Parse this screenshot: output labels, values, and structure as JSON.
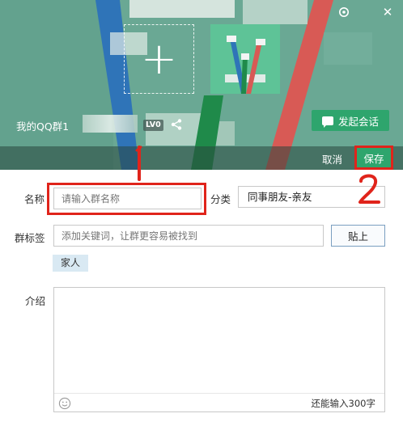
{
  "header": {
    "group_name": "我的QQ群1",
    "level_badge": "LV0",
    "start_chat_label": "发起会话",
    "add_avatar_symbol": "+",
    "close_symbol": "✕",
    "icons": [
      "settings-icon",
      "close-icon",
      "plus-icon",
      "share-icon",
      "chat-bubble-icon"
    ]
  },
  "actions": {
    "cancel_label": "取消",
    "save_label": "保存"
  },
  "form": {
    "name_label": "名称",
    "name_placeholder": "请输入群名称",
    "category_label": "分类",
    "category_value": "同事朋友-亲友",
    "tags_label": "群标签",
    "tags_placeholder": "添加关键词，让群更容易被找到",
    "paste_label": "贴上",
    "tag_chips": [
      "家人"
    ],
    "intro_label": "介绍",
    "intro_value": "",
    "remaining_chars": "还能输入300字"
  },
  "annotations": {
    "step_one": "1",
    "step_two": "2",
    "color": "#e0241b"
  },
  "colors": {
    "accent_green": "#2ea56d",
    "header_bg": "#6aa894",
    "annotation_red": "#e0241b"
  }
}
